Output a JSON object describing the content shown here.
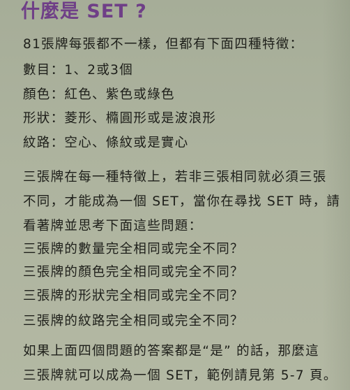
{
  "title": "什麼是 SET ?",
  "intro": "81張牌每張都不一樣，但都有下面四種特徵：",
  "features": [
    "數目：1、2或3個",
    "顏色：紅色、紫色或綠色",
    "形狀：菱形、橢圓形或是波浪形",
    "紋路：空心、條紋或是實心"
  ],
  "paragraph": [
    "三張牌在每一種特徵上，若非三張相同就必須三張",
    "不同，才能成為一個 SET，當你在尋找 SET 時，請",
    "看著牌並思考下面這些問題："
  ],
  "questions": [
    "三張牌的數量完全相同或完全不同？",
    "三張牌的顏色完全相同或完全不同？",
    "三張牌的形狀完全相同或完全不同？",
    "三張牌的紋路完全相同或完全不同？"
  ],
  "conclusion": [
    "如果上面四個問題的答案都是“是” 的話，那麼這",
    "三張牌就可以成為一個 SET，範例請見第 5-7 頁。"
  ]
}
